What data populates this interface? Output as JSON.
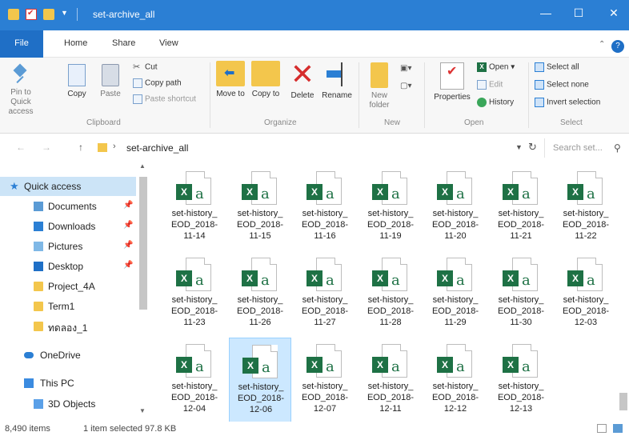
{
  "window": {
    "title": "set-archive_all"
  },
  "tabs": {
    "file": "File",
    "home": "Home",
    "share": "Share",
    "view": "View"
  },
  "ribbon": {
    "clipboard": {
      "pin": "Pin to Quick access",
      "copy": "Copy",
      "paste": "Paste",
      "cut": "Cut",
      "copy_path": "Copy path",
      "paste_shortcut": "Paste shortcut",
      "group": "Clipboard"
    },
    "organize": {
      "move_to": "Move to",
      "copy_to": "Copy to",
      "delete": "Delete",
      "rename": "Rename",
      "group": "Organize"
    },
    "new": {
      "new_folder": "New folder",
      "group": "New"
    },
    "open": {
      "properties": "Properties",
      "open": "Open",
      "edit": "Edit",
      "history": "History",
      "group": "Open"
    },
    "select": {
      "select_all": "Select all",
      "select_none": "Select none",
      "invert": "Invert selection",
      "group": "Select"
    }
  },
  "address": {
    "path": "set-archive_all",
    "search_placeholder": "Search set..."
  },
  "nav": {
    "items": [
      {
        "label": "Quick access",
        "pinned": false
      },
      {
        "label": "Documents",
        "pinned": true
      },
      {
        "label": "Downloads",
        "pinned": true
      },
      {
        "label": "Pictures",
        "pinned": true
      },
      {
        "label": "Desktop",
        "pinned": true
      },
      {
        "label": "Project_4A",
        "pinned": false
      },
      {
        "label": "Term1",
        "pinned": false
      },
      {
        "label": "ทดลอง_1",
        "pinned": false
      },
      {
        "label": "OneDrive",
        "pinned": false
      },
      {
        "label": "This PC",
        "pinned": false
      },
      {
        "label": "3D Objects",
        "pinned": false
      }
    ]
  },
  "files": [
    {
      "l1": "set-history_",
      "l2": "EOD_2018-",
      "l3": "11-14"
    },
    {
      "l1": "set-history_",
      "l2": "EOD_2018-",
      "l3": "11-15"
    },
    {
      "l1": "set-history_",
      "l2": "EOD_2018-",
      "l3": "11-16"
    },
    {
      "l1": "set-history_",
      "l2": "EOD_2018-",
      "l3": "11-19"
    },
    {
      "l1": "set-history_",
      "l2": "EOD_2018-",
      "l3": "11-20"
    },
    {
      "l1": "set-history_",
      "l2": "EOD_2018-",
      "l3": "11-21"
    },
    {
      "l1": "set-history_",
      "l2": "EOD_2018-",
      "l3": "11-22"
    },
    {
      "l1": "set-history_",
      "l2": "EOD_2018-",
      "l3": "11-23"
    },
    {
      "l1": "set-history_",
      "l2": "EOD_2018-",
      "l3": "11-26"
    },
    {
      "l1": "set-history_",
      "l2": "EOD_2018-",
      "l3": "11-27"
    },
    {
      "l1": "set-history_",
      "l2": "EOD_2018-",
      "l3": "11-28"
    },
    {
      "l1": "set-history_",
      "l2": "EOD_2018-",
      "l3": "11-29"
    },
    {
      "l1": "set-history_",
      "l2": "EOD_2018-",
      "l3": "11-30"
    },
    {
      "l1": "set-history_",
      "l2": "EOD_2018-",
      "l3": "12-03"
    },
    {
      "l1": "set-history_",
      "l2": "EOD_2018-",
      "l3": "12-04"
    },
    {
      "l1": "set-history_",
      "l2": "EOD_2018-",
      "l3": "12-06"
    },
    {
      "l1": "set-history_",
      "l2": "EOD_2018-",
      "l3": "12-07"
    },
    {
      "l1": "set-history_",
      "l2": "EOD_2018-",
      "l3": "12-11"
    },
    {
      "l1": "set-history_",
      "l2": "EOD_2018-",
      "l3": "12-12"
    },
    {
      "l1": "set-history_",
      "l2": "EOD_2018-",
      "l3": "12-13"
    }
  ],
  "selected_file": "set-history_EOD_2018-12-06",
  "status": {
    "count": "8,490 items",
    "selection": "1 item selected  97.8 KB"
  },
  "colors": {
    "titlebar": "#2b7fd4",
    "file_tab": "#1f6fc6",
    "selection": "#cce8ff",
    "excel": "#1e7145"
  }
}
